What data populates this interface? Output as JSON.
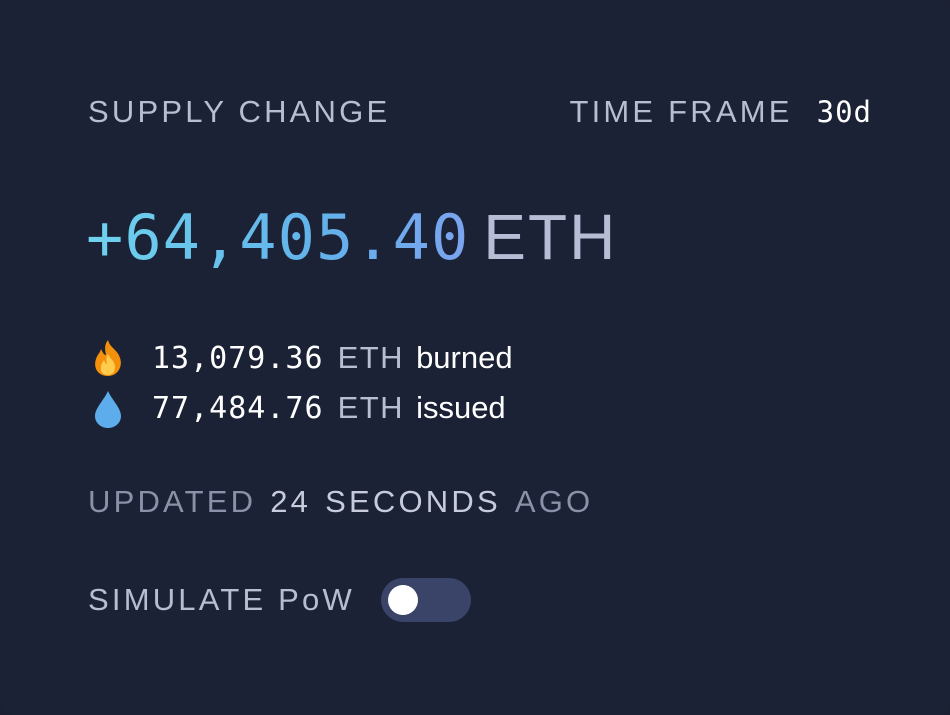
{
  "header": {
    "supply_label": "SUPPLY CHANGE",
    "timeframe_label": "TIME FRAME",
    "timeframe_value": "30d"
  },
  "supply": {
    "change_value": "+64,405.40",
    "unit": "ETH"
  },
  "stats": {
    "burned": {
      "icon": "fire-icon",
      "value": "13,079.36",
      "unit": "ETH",
      "label": "burned"
    },
    "issued": {
      "icon": "droplet-icon",
      "value": "77,484.76",
      "unit": "ETH",
      "label": "issued"
    }
  },
  "updated": {
    "prefix": "UPDATED",
    "amount": "24",
    "unit": "SECONDS",
    "suffix": "AGO"
  },
  "simulate": {
    "label": "SIMULATE PoW",
    "enabled": false
  },
  "colors": {
    "background": "#1b2236",
    "accent_gradient_start": "#6fd3ee",
    "accent_gradient_end": "#7ba3ef",
    "toggle_track": "#3a4468"
  }
}
